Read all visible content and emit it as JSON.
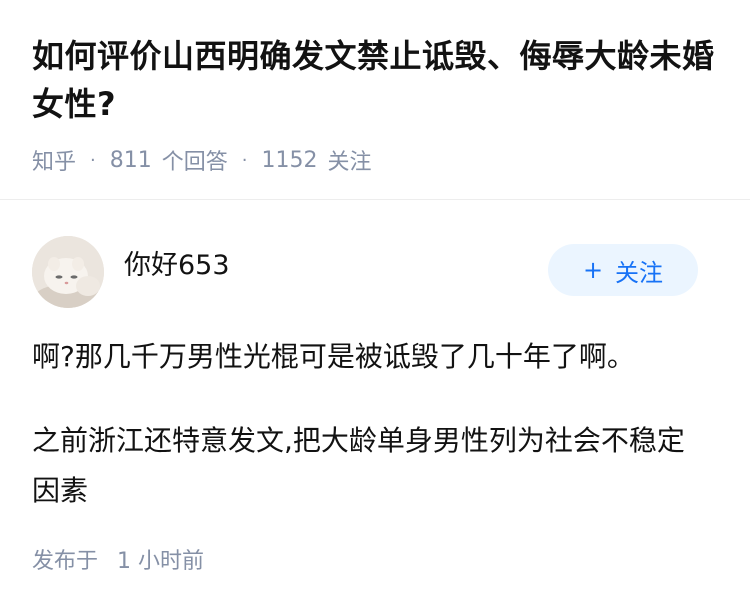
{
  "question": {
    "title": "如何评价山西明确发文禁止诋毁、侮辱大龄未婚女性?",
    "source": "知乎",
    "answer_count": "811",
    "answer_count_label": "个回答",
    "follower_count": "1152",
    "follower_count_label": "关注",
    "separator": "·"
  },
  "answer": {
    "author": {
      "name": "你好653",
      "avatar_icon": "kitten-avatar"
    },
    "follow_button": {
      "plus": "+",
      "label": "关注"
    },
    "paragraphs": [
      "啊?那几千万男性光棍可是被诋毁了几十年了啊。",
      "之前浙江还特意发文,把大龄单身男性列为社会不稳定因素"
    ],
    "time_label": "发布于",
    "time_value": "1 小时前"
  },
  "colors": {
    "text_primary": "#121212",
    "text_secondary": "#8590a6",
    "accent": "#1772f6",
    "follow_bg": "#ebf5ff"
  }
}
